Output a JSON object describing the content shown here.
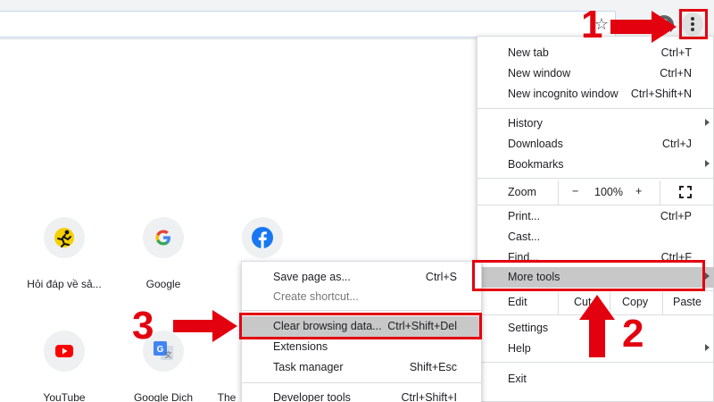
{
  "toolbar": {
    "star_icon": "star-icon",
    "profile_icon": "account-circle-icon",
    "menu_icon": "kebab-menu-icon"
  },
  "shortcuts": [
    {
      "label": "Hỏi đáp về sả...",
      "icon": "runner-icon"
    },
    {
      "label": "Google",
      "icon": "google-g-icon"
    },
    {
      "label": "",
      "icon": "facebook-icon"
    },
    {
      "label": "YouTube",
      "icon": "youtube-icon"
    },
    {
      "label": "Google Dich",
      "icon": "google-translate-icon"
    },
    {
      "label": "The",
      "icon": ""
    }
  ],
  "menu": {
    "new_tab": {
      "label": "New tab",
      "shortcut": "Ctrl+T"
    },
    "new_window": {
      "label": "New window",
      "shortcut": "Ctrl+N"
    },
    "new_incognito": {
      "label": "New incognito window",
      "shortcut": "Ctrl+Shift+N"
    },
    "history": {
      "label": "History"
    },
    "downloads": {
      "label": "Downloads",
      "shortcut": "Ctrl+J"
    },
    "bookmarks": {
      "label": "Bookmarks"
    },
    "zoom": {
      "label": "Zoom",
      "minus": "−",
      "value": "100%",
      "plus": "+"
    },
    "print": {
      "label": "Print...",
      "shortcut": "Ctrl+P"
    },
    "cast": {
      "label": "Cast..."
    },
    "find": {
      "label": "Find...",
      "shortcut": "Ctrl+F"
    },
    "more_tools": {
      "label": "More tools"
    },
    "edit": {
      "label": "Edit",
      "cut": "Cut",
      "copy": "Copy",
      "paste": "Paste"
    },
    "settings": {
      "label": "Settings"
    },
    "help": {
      "label": "Help"
    },
    "exit": {
      "label": "Exit"
    }
  },
  "submenu": {
    "save_page": {
      "label": "Save page as...",
      "shortcut": "Ctrl+S"
    },
    "create_shortcut": {
      "label": "Create shortcut..."
    },
    "clear_browsing": {
      "label": "Clear browsing data...",
      "shortcut": "Ctrl+Shift+Del"
    },
    "extensions": {
      "label": "Extensions"
    },
    "task_manager": {
      "label": "Task manager",
      "shortcut": "Shift+Esc"
    },
    "developer_tools": {
      "label": "Developer tools",
      "shortcut": "Ctrl+Shift+I"
    }
  },
  "annotations": {
    "step1": "1",
    "step2": "2",
    "step3": "3",
    "color": "#e3000f"
  }
}
